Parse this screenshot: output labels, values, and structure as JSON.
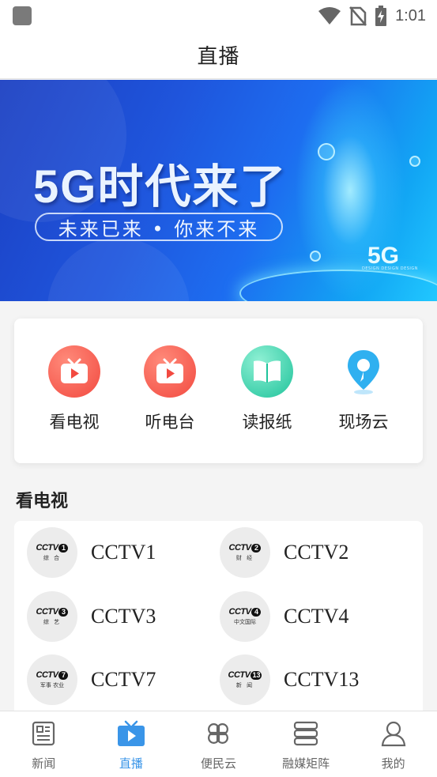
{
  "status_bar": {
    "time": "1:01",
    "icons": [
      "notification-square-icon",
      "wifi-icon",
      "no-sim-icon",
      "battery-charging-icon"
    ]
  },
  "header": {
    "title": "直播"
  },
  "banner": {
    "headline": "5G时代来了",
    "subtitle": "未来已来 • 你来不来",
    "badge": "5G",
    "badge_tagline": "DESIGN DESIGN DESIGN"
  },
  "quick_entries": [
    {
      "label": "看电视",
      "icon": "tv-play-icon",
      "color": "#f45a4f"
    },
    {
      "label": "听电台",
      "icon": "radio-play-icon",
      "color": "#f45a4f"
    },
    {
      "label": "读报纸",
      "icon": "book-icon",
      "color": "#2dcfa8"
    },
    {
      "label": "现场云",
      "icon": "location-pin-icon",
      "color": "#3bb6f2"
    }
  ],
  "tv_section": {
    "title": "看电视",
    "channels": [
      {
        "name": "CCTV1",
        "logo_text": "CCTV",
        "logo_number": "1",
        "logo_sub": "综 合"
      },
      {
        "name": "CCTV2",
        "logo_text": "CCTV",
        "logo_number": "2",
        "logo_sub": "财 经"
      },
      {
        "name": "CCTV3",
        "logo_text": "CCTV",
        "logo_number": "3",
        "logo_sub": "综 艺"
      },
      {
        "name": "CCTV4",
        "logo_text": "CCTV",
        "logo_number": "4",
        "logo_sub": "中文国际"
      },
      {
        "name": "CCTV7",
        "logo_text": "CCTV",
        "logo_number": "7",
        "logo_sub": "军事 农业"
      },
      {
        "name": "CCTV13",
        "logo_text": "CCTV",
        "logo_number": "13",
        "logo_sub": "新 闻"
      }
    ]
  },
  "bottom_nav": {
    "active": "直播",
    "active_color": "#3a95e8",
    "items": [
      {
        "label": "新闻",
        "icon": "newspaper-icon"
      },
      {
        "label": "直播",
        "icon": "live-tv-icon"
      },
      {
        "label": "便民云",
        "icon": "grid-petals-icon"
      },
      {
        "label": "融媒矩阵",
        "icon": "layers-icon"
      },
      {
        "label": "我的",
        "icon": "user-icon"
      }
    ]
  }
}
